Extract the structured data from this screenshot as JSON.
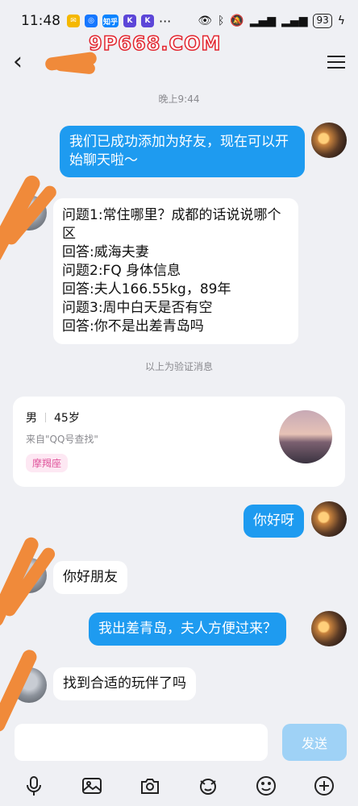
{
  "status_bar": {
    "time": "11:48",
    "app_badges": [
      "知乎",
      "K",
      "K"
    ],
    "more": "···",
    "battery": "93"
  },
  "watermark": "9P668.COM",
  "header": {
    "back_icon": "back-chevron-icon",
    "menu_icon": "hamburger-menu-icon"
  },
  "chat": {
    "timestamp": "晚上9:44",
    "messages": [
      {
        "side": "out",
        "text": "我们已成功添加为好友，现在可以开始聊天啦～"
      },
      {
        "side": "in",
        "lines": [
          "问题1:常住哪里？成都的话说说哪个区",
          "回答:威海夫妻",
          "问题2:FQ 身体信息",
          "回答:夫人166.55kg，89年",
          "问题3:周中白天是否有空",
          "回答:你不是出差青岛吗"
        ]
      }
    ],
    "verify_note": "以上为验证消息",
    "profile": {
      "gender": "男",
      "age": "45岁",
      "source": "来自\"QQ号查找\"",
      "tag": "摩羯座"
    },
    "later_messages": [
      {
        "side": "out",
        "text": "你好呀"
      },
      {
        "side": "in",
        "text": "你好朋友"
      },
      {
        "side": "out",
        "text": "我出差青岛，夫人方便过来？"
      },
      {
        "side": "in",
        "text": "找到合适的玩伴了吗"
      }
    ]
  },
  "input": {
    "placeholder": "",
    "send_label": "发送"
  },
  "toolbar": {
    "icons": [
      "microphone-icon",
      "image-icon",
      "camera-icon",
      "sticker-icon",
      "emoji-icon",
      "plus-icon"
    ]
  },
  "colors": {
    "accent": "#1e9bf0",
    "background": "#eff0f4",
    "send_disabled": "#9fd2f6",
    "tag_text": "#e0559c"
  }
}
